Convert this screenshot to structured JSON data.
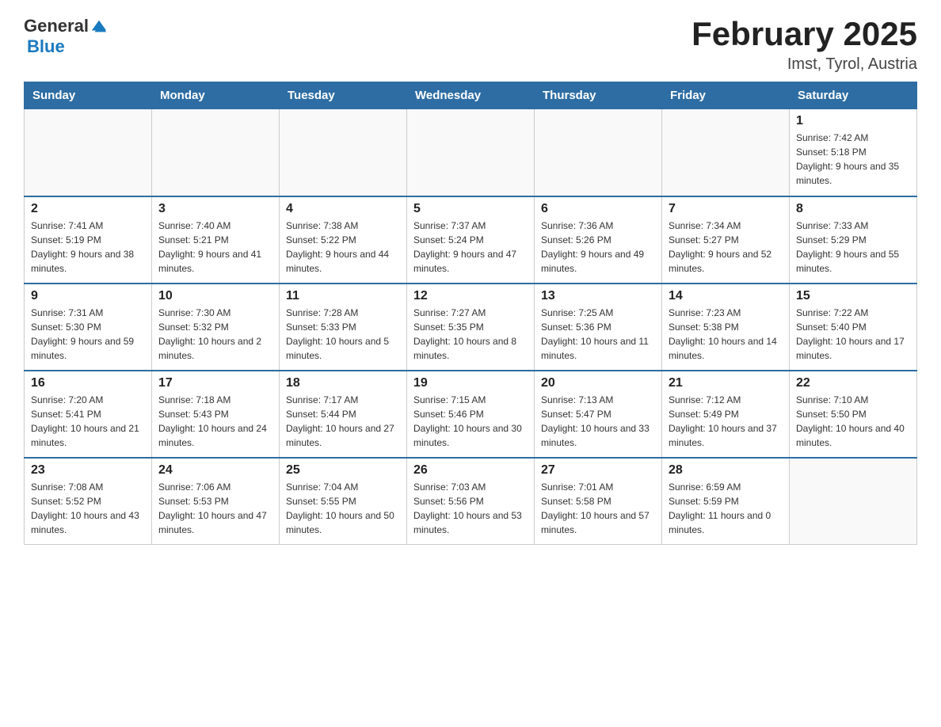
{
  "header": {
    "logo_general": "General",
    "logo_blue": "Blue",
    "month_title": "February 2025",
    "location": "Imst, Tyrol, Austria"
  },
  "days_of_week": [
    "Sunday",
    "Monday",
    "Tuesday",
    "Wednesday",
    "Thursday",
    "Friday",
    "Saturday"
  ],
  "weeks": [
    [
      {
        "day": "",
        "info": ""
      },
      {
        "day": "",
        "info": ""
      },
      {
        "day": "",
        "info": ""
      },
      {
        "day": "",
        "info": ""
      },
      {
        "day": "",
        "info": ""
      },
      {
        "day": "",
        "info": ""
      },
      {
        "day": "1",
        "info": "Sunrise: 7:42 AM\nSunset: 5:18 PM\nDaylight: 9 hours and 35 minutes."
      }
    ],
    [
      {
        "day": "2",
        "info": "Sunrise: 7:41 AM\nSunset: 5:19 PM\nDaylight: 9 hours and 38 minutes."
      },
      {
        "day": "3",
        "info": "Sunrise: 7:40 AM\nSunset: 5:21 PM\nDaylight: 9 hours and 41 minutes."
      },
      {
        "day": "4",
        "info": "Sunrise: 7:38 AM\nSunset: 5:22 PM\nDaylight: 9 hours and 44 minutes."
      },
      {
        "day": "5",
        "info": "Sunrise: 7:37 AM\nSunset: 5:24 PM\nDaylight: 9 hours and 47 minutes."
      },
      {
        "day": "6",
        "info": "Sunrise: 7:36 AM\nSunset: 5:26 PM\nDaylight: 9 hours and 49 minutes."
      },
      {
        "day": "7",
        "info": "Sunrise: 7:34 AM\nSunset: 5:27 PM\nDaylight: 9 hours and 52 minutes."
      },
      {
        "day": "8",
        "info": "Sunrise: 7:33 AM\nSunset: 5:29 PM\nDaylight: 9 hours and 55 minutes."
      }
    ],
    [
      {
        "day": "9",
        "info": "Sunrise: 7:31 AM\nSunset: 5:30 PM\nDaylight: 9 hours and 59 minutes."
      },
      {
        "day": "10",
        "info": "Sunrise: 7:30 AM\nSunset: 5:32 PM\nDaylight: 10 hours and 2 minutes."
      },
      {
        "day": "11",
        "info": "Sunrise: 7:28 AM\nSunset: 5:33 PM\nDaylight: 10 hours and 5 minutes."
      },
      {
        "day": "12",
        "info": "Sunrise: 7:27 AM\nSunset: 5:35 PM\nDaylight: 10 hours and 8 minutes."
      },
      {
        "day": "13",
        "info": "Sunrise: 7:25 AM\nSunset: 5:36 PM\nDaylight: 10 hours and 11 minutes."
      },
      {
        "day": "14",
        "info": "Sunrise: 7:23 AM\nSunset: 5:38 PM\nDaylight: 10 hours and 14 minutes."
      },
      {
        "day": "15",
        "info": "Sunrise: 7:22 AM\nSunset: 5:40 PM\nDaylight: 10 hours and 17 minutes."
      }
    ],
    [
      {
        "day": "16",
        "info": "Sunrise: 7:20 AM\nSunset: 5:41 PM\nDaylight: 10 hours and 21 minutes."
      },
      {
        "day": "17",
        "info": "Sunrise: 7:18 AM\nSunset: 5:43 PM\nDaylight: 10 hours and 24 minutes."
      },
      {
        "day": "18",
        "info": "Sunrise: 7:17 AM\nSunset: 5:44 PM\nDaylight: 10 hours and 27 minutes."
      },
      {
        "day": "19",
        "info": "Sunrise: 7:15 AM\nSunset: 5:46 PM\nDaylight: 10 hours and 30 minutes."
      },
      {
        "day": "20",
        "info": "Sunrise: 7:13 AM\nSunset: 5:47 PM\nDaylight: 10 hours and 33 minutes."
      },
      {
        "day": "21",
        "info": "Sunrise: 7:12 AM\nSunset: 5:49 PM\nDaylight: 10 hours and 37 minutes."
      },
      {
        "day": "22",
        "info": "Sunrise: 7:10 AM\nSunset: 5:50 PM\nDaylight: 10 hours and 40 minutes."
      }
    ],
    [
      {
        "day": "23",
        "info": "Sunrise: 7:08 AM\nSunset: 5:52 PM\nDaylight: 10 hours and 43 minutes."
      },
      {
        "day": "24",
        "info": "Sunrise: 7:06 AM\nSunset: 5:53 PM\nDaylight: 10 hours and 47 minutes."
      },
      {
        "day": "25",
        "info": "Sunrise: 7:04 AM\nSunset: 5:55 PM\nDaylight: 10 hours and 50 minutes."
      },
      {
        "day": "26",
        "info": "Sunrise: 7:03 AM\nSunset: 5:56 PM\nDaylight: 10 hours and 53 minutes."
      },
      {
        "day": "27",
        "info": "Sunrise: 7:01 AM\nSunset: 5:58 PM\nDaylight: 10 hours and 57 minutes."
      },
      {
        "day": "28",
        "info": "Sunrise: 6:59 AM\nSunset: 5:59 PM\nDaylight: 11 hours and 0 minutes."
      },
      {
        "day": "",
        "info": ""
      }
    ]
  ]
}
